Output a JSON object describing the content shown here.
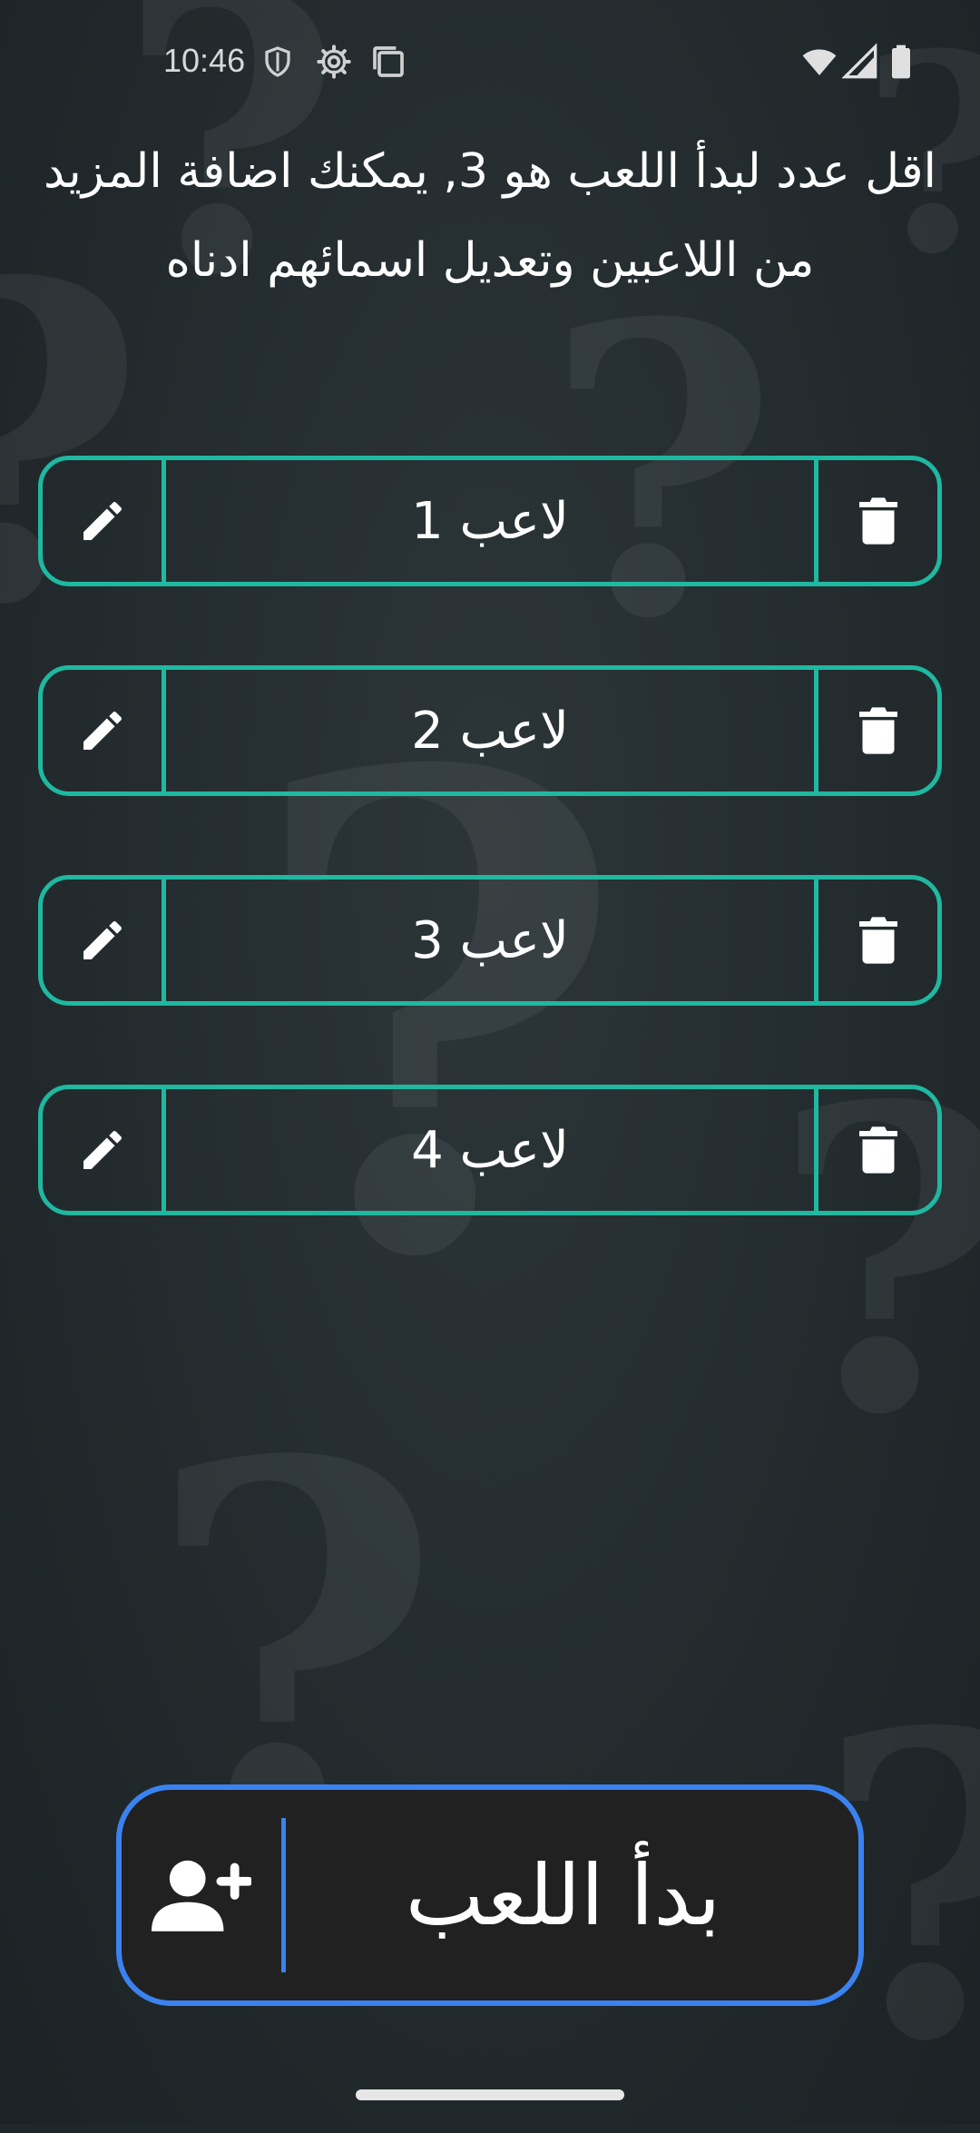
{
  "status_bar": {
    "time": "10:46",
    "icons": [
      "shield-icon",
      "gear-icon",
      "screenshot-icon",
      "wifi-icon",
      "signal-icon",
      "battery-icon"
    ]
  },
  "instructions": "اقل عدد لبدأ اللعب هو 3, يمكنك اضافة المزيد من اللاعبين وتعديل اسمائهم ادناه",
  "players": [
    {
      "name": "لاعب 1"
    },
    {
      "name": "لاعب 2"
    },
    {
      "name": "لاعب 3"
    },
    {
      "name": "لاعب 4"
    }
  ],
  "start_button": {
    "label": "بدأ اللعب",
    "add_icon": "person-add-icon"
  },
  "colors": {
    "player_border": "#1fb8a0",
    "start_border": "#3b82f0",
    "background": "#20272a"
  }
}
